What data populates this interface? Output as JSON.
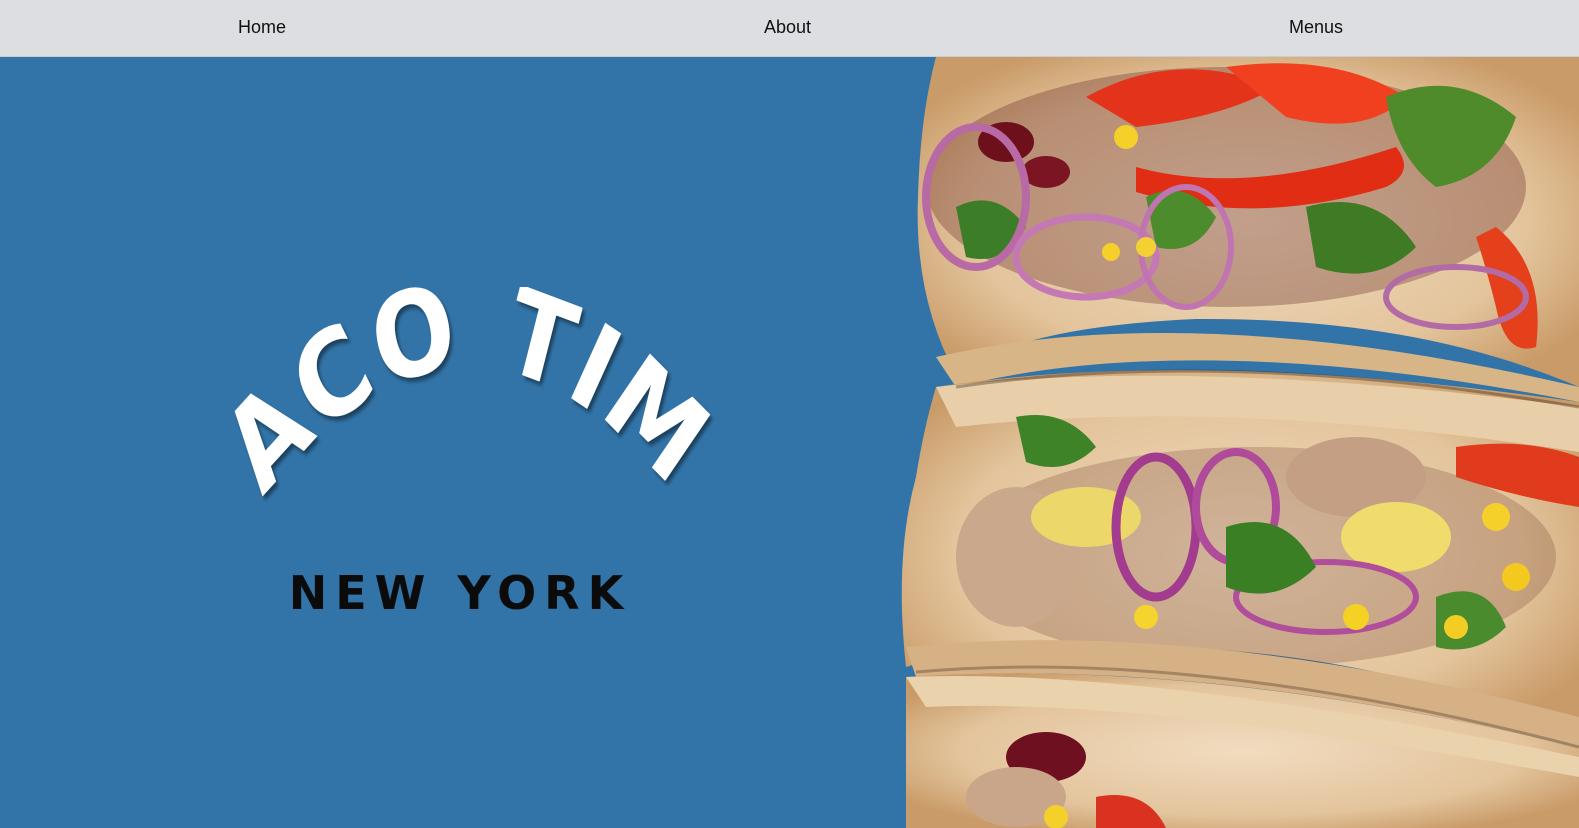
{
  "nav": {
    "items": [
      {
        "label": "Home"
      },
      {
        "label": "About"
      },
      {
        "label": "Menus"
      }
    ]
  },
  "hero": {
    "logo_line1": "TACO TIME",
    "logo_line2": "NEW YORK",
    "logo_text_color": "#ffffff",
    "subtitle_color": "#0b0b0b",
    "background_color": "#3274a8",
    "image_icon": "tacos-photo"
  },
  "colors": {
    "nav_background": "#dcdee1",
    "nav_text": "#111111",
    "hero_background": "#3274a8"
  }
}
